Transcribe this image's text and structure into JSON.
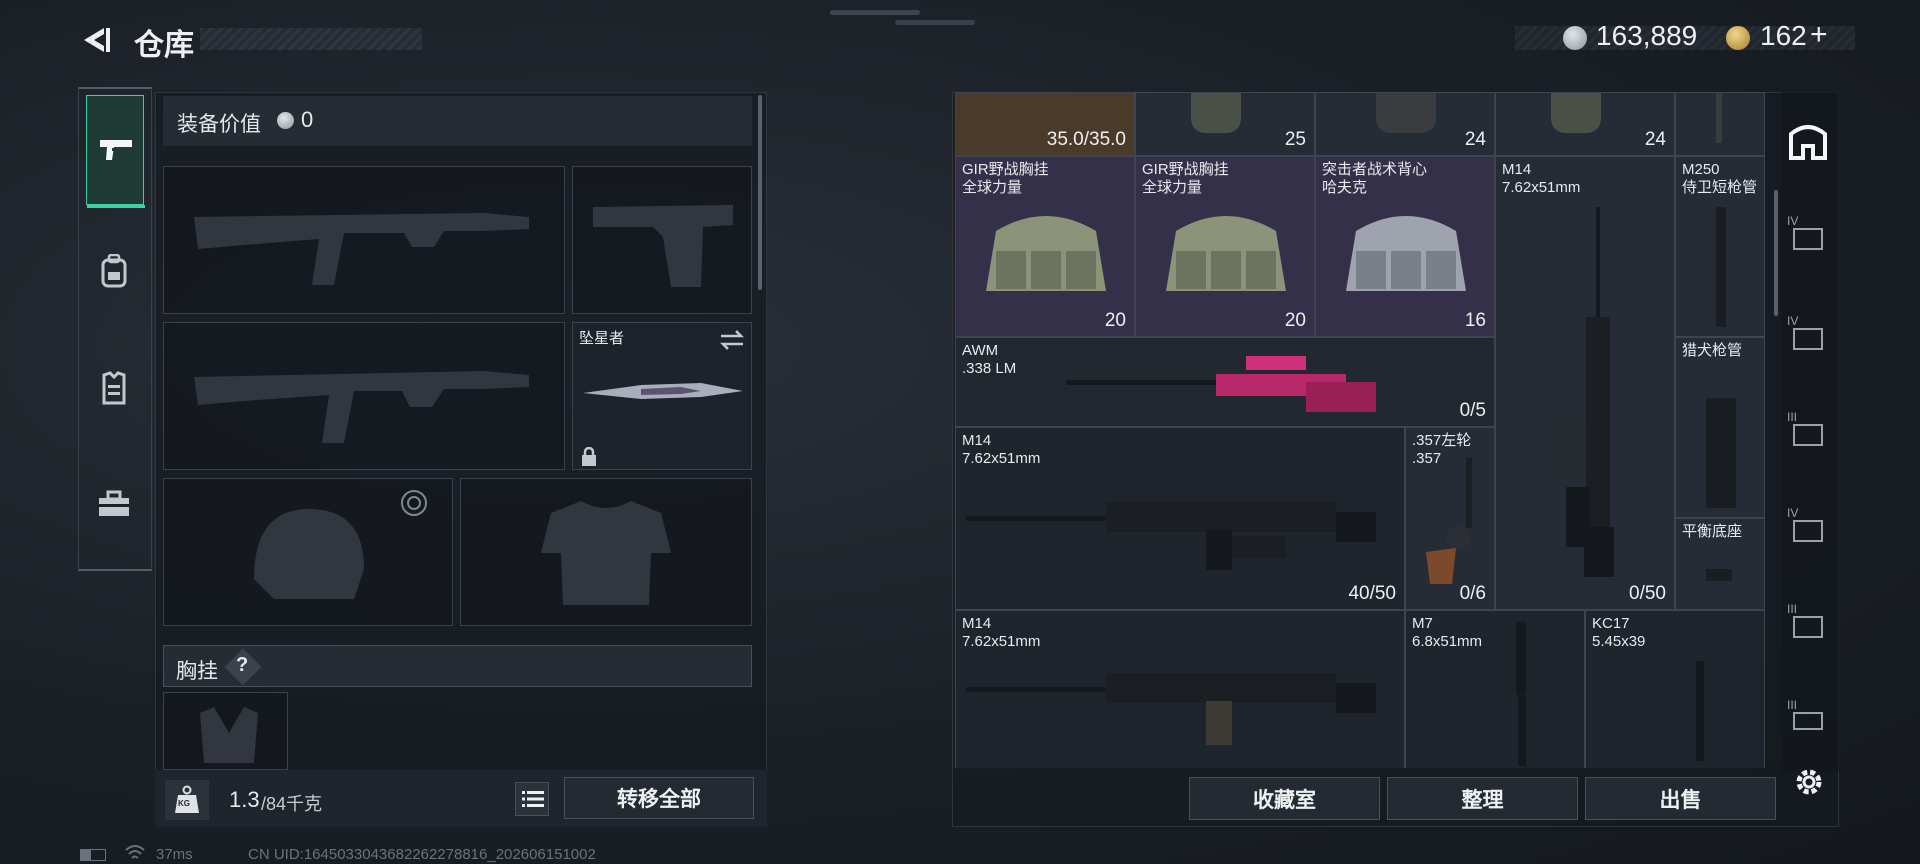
{
  "header": {
    "title": "仓库",
    "currency_coins": "163,889",
    "currency_premium": "162",
    "premium_plus": "+"
  },
  "loadout": {
    "value_label": "装备价值",
    "value": "0",
    "melee_name": "坠星者",
    "chest_rig_label": "胸挂",
    "help_mark": "?",
    "weight_current": "1.3",
    "weight_max": "/84千克",
    "weight_badge": "KG",
    "transfer_all": "转移全部"
  },
  "stash": {
    "top_row": [
      "35.0/35.0",
      "25",
      "24",
      "24"
    ],
    "items": [
      {
        "name": "GIR野战胸挂\n全球力量",
        "count": "20"
      },
      {
        "name": "GIR野战胸挂\n全球力量",
        "count": "20"
      },
      {
        "name": "突击者战术背心\n哈夫克",
        "count": "16"
      },
      {
        "name": "M14\n7.62x51mm",
        "count": "0/50"
      },
      {
        "name": "M250\n侍卫短枪管",
        "count": ""
      },
      {
        "name": "AWM\n.338 LM",
        "count": "0/5"
      },
      {
        "name": "猎犬枪管",
        "count": ""
      },
      {
        "name": "M14\n7.62x51mm",
        "count": "40/50"
      },
      {
        "name": ".357左轮\n.357",
        "count": "0/6"
      },
      {
        "name": "平衡底座",
        "count": ""
      },
      {
        "name": "M14\n7.62x51mm",
        "count": ""
      },
      {
        "name": "M7\n6.8x51mm",
        "count": ""
      },
      {
        "name": "KC17\n5.45x39",
        "count": ""
      }
    ],
    "buttons": {
      "collection": "收藏室",
      "sort": "整理",
      "sell": "出售"
    }
  },
  "right_rail": {
    "tier_labels": [
      "IV",
      "IV",
      "III",
      "IV",
      "III",
      "III"
    ]
  },
  "status": {
    "ping": "37ms",
    "uid": "CN UID:1645033043682262278816_202606151002"
  },
  "colors": {
    "accent_green": "#3fd1a1",
    "tile_purple": "#35304a",
    "tile_gray": "#252c36",
    "awm_pink": "#d0307a"
  },
  "icons": [
    "back-arrow-icon",
    "coin-icon",
    "premium-coin-icon",
    "pistol-icon",
    "backpack-icon",
    "vest-icon",
    "toolbox-icon",
    "kg-weight-icon",
    "list-icon",
    "gear-icon",
    "switch-icon",
    "lock-icon"
  ]
}
